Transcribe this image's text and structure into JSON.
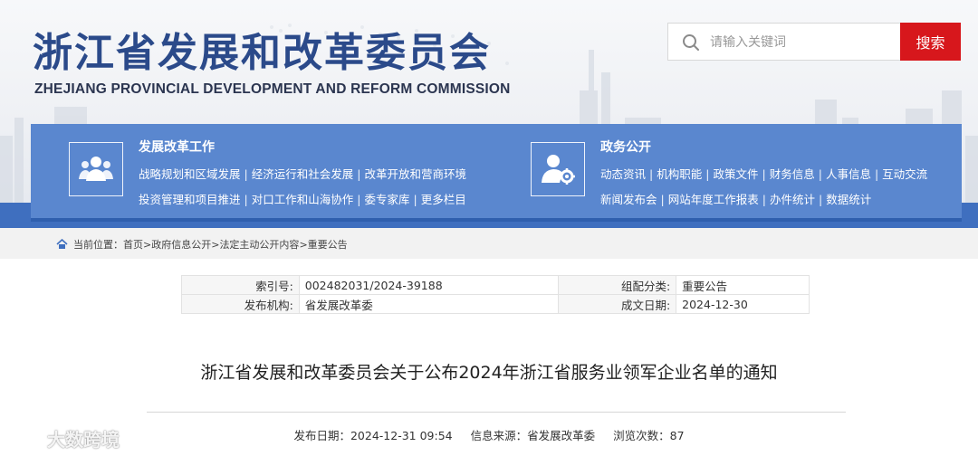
{
  "header": {
    "title_cn": "浙江省发展和改革委员会",
    "title_en": "ZHEJIANG PROVINCIAL DEVELOPMENT AND REFORM COMMISSION"
  },
  "search": {
    "placeholder": "请输入关键词",
    "button_label": "搜索"
  },
  "nav": {
    "reform": {
      "title": "发展改革工作",
      "icon": "people-group-icon",
      "line1": [
        "战略规划和区域发展",
        "经济运行和社会发展",
        "改革开放和营商环境"
      ],
      "line2": [
        "投资管理和项目推进",
        "对口工作和山海协作",
        "委专家库",
        "更多栏目"
      ]
    },
    "affairs": {
      "title": "政务公开",
      "icon": "user-gear-icon",
      "line1": [
        "动态资讯",
        "机构职能",
        "政策文件",
        "财务信息",
        "人事信息",
        "互动交流"
      ],
      "line2": [
        "新闻发布会",
        "网站年度工作报表",
        "办件统计",
        "数据统计"
      ]
    },
    "separator": "|"
  },
  "breadcrumb": {
    "label": "当前位置：",
    "items": [
      "首页",
      "政府信息公开",
      "法定主动公开内容",
      "重要公告"
    ],
    "separator": ">"
  },
  "meta": {
    "index_label": "索引号:",
    "index_value": "002482031/2024-39188",
    "category_label": "组配分类:",
    "category_value": "重要公告",
    "publisher_label": "发布机构:",
    "publisher_value": "省发展改革委",
    "issue_date_label": "成文日期:",
    "issue_date_value": "2024-12-30"
  },
  "article": {
    "title": "浙江省发展和改革委员会关于公布2024年浙江省服务业领军企业名单的通知",
    "publish_label": "发布日期：",
    "publish_value": "2024-12-31 09:54",
    "source_label": "信息来源：",
    "source_value": "省发展改革委",
    "views_label": "浏览次数：",
    "views_value": "87"
  },
  "watermark": {
    "text": "大数跨境"
  },
  "colors": {
    "brand_blue": "#2b4a8a",
    "nav_blue": "#5a87cf",
    "search_red": "#d7171c"
  }
}
